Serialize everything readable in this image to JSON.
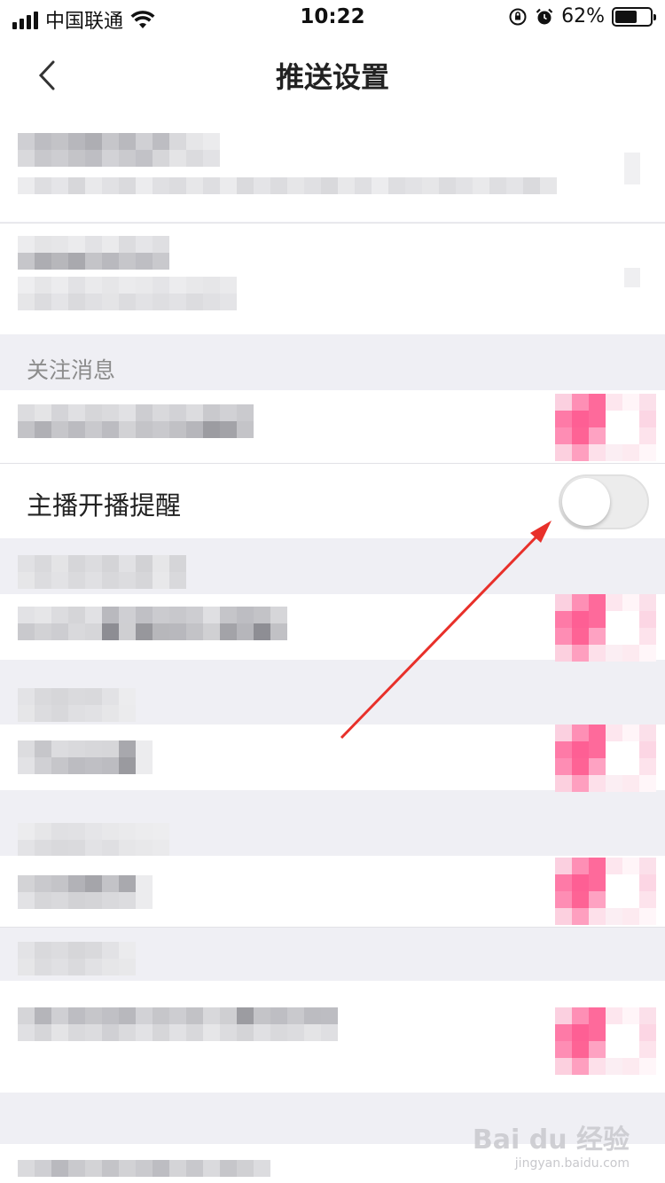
{
  "status_bar": {
    "carrier": "中国联通",
    "time": "10:22",
    "battery_percent": "62%",
    "battery_level": 0.62,
    "icons": [
      "signal-icon",
      "wifi-icon",
      "orientation-lock-icon",
      "alarm-icon",
      "battery-icon"
    ]
  },
  "nav": {
    "title": "推送设置",
    "back_icon": "chevron-left-icon"
  },
  "sections": {
    "follow_header": "关注消息",
    "live_reminder_label": "主播开播提醒",
    "live_reminder_on": false
  },
  "colors": {
    "toggle_on_pink": "#fe6a9b",
    "toggle_off": "#ececec",
    "arrow": "#e8302a",
    "background": "#efeff4"
  },
  "watermark": {
    "brand": "Bai du 经验",
    "url": "jingyan.baidu.com"
  }
}
